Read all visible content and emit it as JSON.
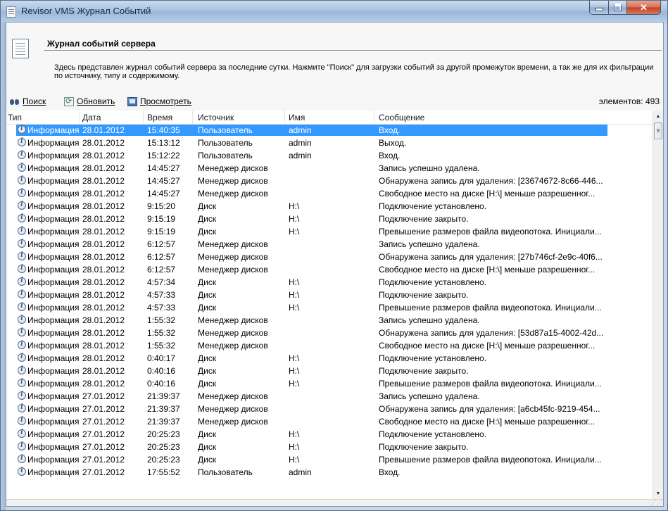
{
  "window": {
    "title": "Revisor VMS Журнал Событий",
    "controls": {
      "minimize": "_",
      "maximize": "□",
      "close": "✕"
    }
  },
  "header": {
    "title": "Журнал событий сервера",
    "description": "Здесь представлен журнал событий сервера за последние сутки. Нажмите \"Поиск\" для загрузки событий за другой промежуток времени, а так же для их фильтрации по источнику, типу и содержимому."
  },
  "toolbar": {
    "search_label": "Поиск",
    "refresh_label": "Обновить",
    "view_label": "Просмотреть",
    "count_label": "элементов: 493"
  },
  "columns": [
    "Тип",
    "Дата",
    "Время",
    "Источник",
    "Имя",
    "Сообщение"
  ],
  "rows": [
    [
      "Информация",
      "28.01.2012",
      "15:40:35",
      "Пользователь",
      "admin",
      "Вход."
    ],
    [
      "Информация",
      "28.01.2012",
      "15:13:12",
      "Пользователь",
      "admin",
      "Выход."
    ],
    [
      "Информация",
      "28.01.2012",
      "15:12:22",
      "Пользователь",
      "admin",
      "Вход."
    ],
    [
      "Информация",
      "28.01.2012",
      "14:45:27",
      "Менеджер дисков",
      "",
      "Запись успешно удалена."
    ],
    [
      "Информация",
      "28.01.2012",
      "14:45:27",
      "Менеджер дисков",
      "",
      "Обнаружена запись для удаления: [23674672-8c66-446..."
    ],
    [
      "Информация",
      "28.01.2012",
      "14:45:27",
      "Менеджер дисков",
      "",
      "Свободное место на диске  [H:\\] меньше разрешенног..."
    ],
    [
      "Информация",
      "28.01.2012",
      "9:15:20",
      "Диск",
      "H:\\",
      "Подключение установлено."
    ],
    [
      "Информация",
      "28.01.2012",
      "9:15:19",
      "Диск",
      "H:\\",
      "Подключение закрыто."
    ],
    [
      "Информация",
      "28.01.2012",
      "9:15:19",
      "Диск",
      "H:\\",
      "Превышение размеров файла видеопотока. Инициали..."
    ],
    [
      "Информация",
      "28.01.2012",
      "6:12:57",
      "Менеджер дисков",
      "",
      "Запись успешно удалена."
    ],
    [
      "Информация",
      "28.01.2012",
      "6:12:57",
      "Менеджер дисков",
      "",
      "Обнаружена запись для удаления: [27b746cf-2e9c-40f6..."
    ],
    [
      "Информация",
      "28.01.2012",
      "6:12:57",
      "Менеджер дисков",
      "",
      "Свободное место на диске  [H:\\] меньше разрешенног..."
    ],
    [
      "Информация",
      "28.01.2012",
      "4:57:34",
      "Диск",
      "H:\\",
      "Подключение установлено."
    ],
    [
      "Информация",
      "28.01.2012",
      "4:57:33",
      "Диск",
      "H:\\",
      "Подключение закрыто."
    ],
    [
      "Информация",
      "28.01.2012",
      "4:57:33",
      "Диск",
      "H:\\",
      "Превышение размеров файла видеопотока. Инициали..."
    ],
    [
      "Информация",
      "28.01.2012",
      "1:55:32",
      "Менеджер дисков",
      "",
      "Запись успешно удалена."
    ],
    [
      "Информация",
      "28.01.2012",
      "1:55:32",
      "Менеджер дисков",
      "",
      "Обнаружена запись для удаления: [53d87a15-4002-42d..."
    ],
    [
      "Информация",
      "28.01.2012",
      "1:55:32",
      "Менеджер дисков",
      "",
      "Свободное место на диске  [H:\\] меньше разрешенног..."
    ],
    [
      "Информация",
      "28.01.2012",
      "0:40:17",
      "Диск",
      "H:\\",
      "Подключение установлено."
    ],
    [
      "Информация",
      "28.01.2012",
      "0:40:16",
      "Диск",
      "H:\\",
      "Подключение закрыто."
    ],
    [
      "Информация",
      "28.01.2012",
      "0:40:16",
      "Диск",
      "H:\\",
      "Превышение размеров файла видеопотока. Инициали..."
    ],
    [
      "Информация",
      "27.01.2012",
      "21:39:37",
      "Менеджер дисков",
      "",
      "Запись успешно удалена."
    ],
    [
      "Информация",
      "27.01.2012",
      "21:39:37",
      "Менеджер дисков",
      "",
      "Обнаружена запись для удаления: [a6cb45fc-9219-454..."
    ],
    [
      "Информация",
      "27.01.2012",
      "21:39:37",
      "Менеджер дисков",
      "",
      "Свободное место на диске  [H:\\] меньше разрешенног..."
    ],
    [
      "Информация",
      "27.01.2012",
      "20:25:23",
      "Диск",
      "H:\\",
      "Подключение установлено."
    ],
    [
      "Информация",
      "27.01.2012",
      "20:25:23",
      "Диск",
      "H:\\",
      "Подключение закрыто."
    ],
    [
      "Информация",
      "27.01.2012",
      "20:25:23",
      "Диск",
      "H:\\",
      "Превышение размеров файла видеопотока. Инициали..."
    ],
    [
      "Информация",
      "27.01.2012",
      "17:55:52",
      "Пользователь",
      "admin",
      "Вход."
    ]
  ],
  "selected_row": 0,
  "colors": {
    "selection": "#3399ff",
    "title_gradient": "#a7c1e0",
    "close_button": "#c4401f"
  },
  "icons": {
    "row_type": "info-icon",
    "search": "binoculars-icon",
    "refresh": "refresh-icon",
    "view": "view-icon"
  }
}
